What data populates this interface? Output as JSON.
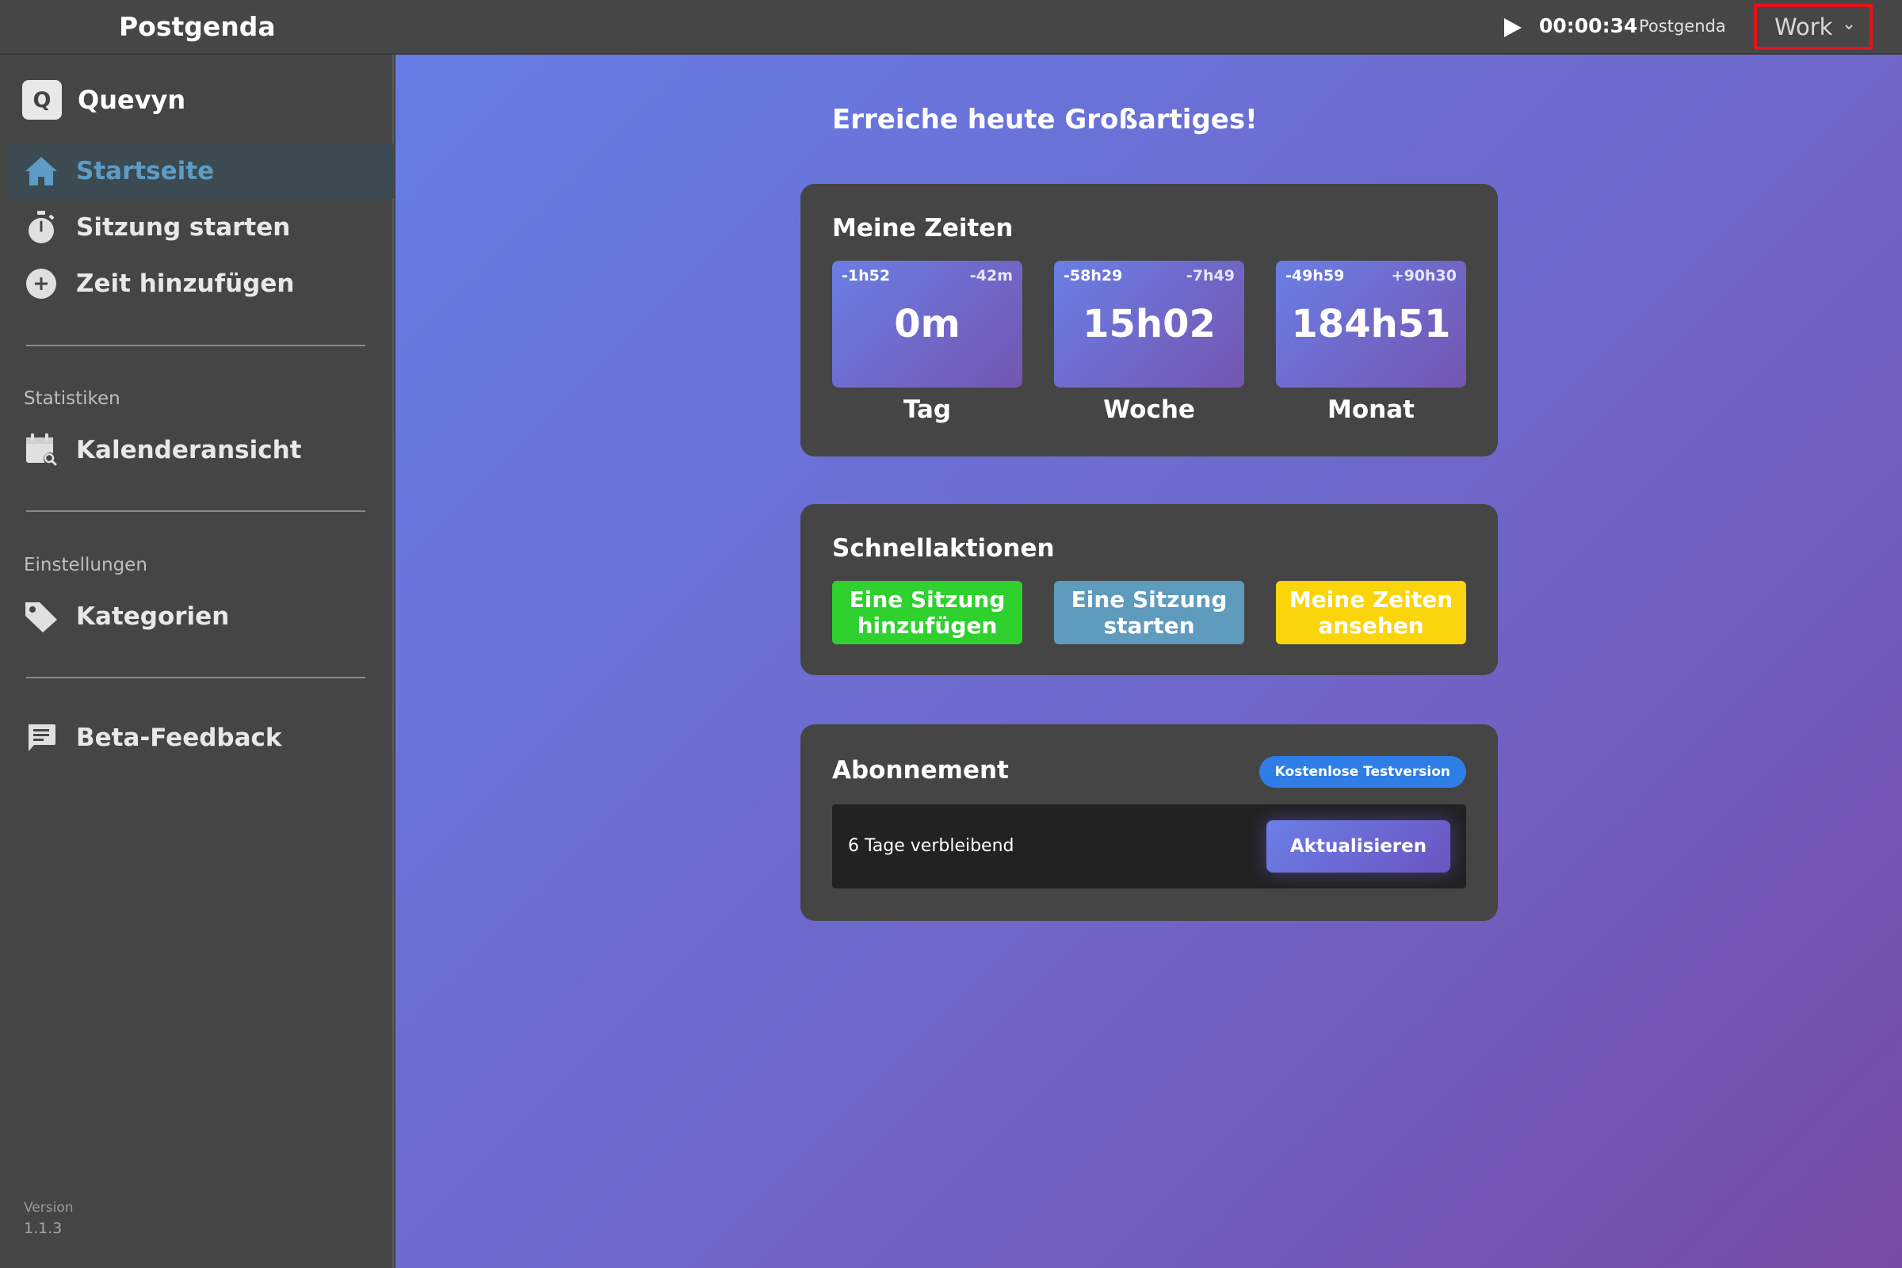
{
  "topbar": {
    "app_title": "Postgenda",
    "timer": "00:00:34",
    "project": "Postgenda",
    "category": "Work"
  },
  "sidebar": {
    "brand_initial": "Q",
    "brand_name": "Quevyn",
    "items": [
      {
        "label": "Startseite",
        "icon": "home-icon",
        "active": true
      },
      {
        "label": "Sitzung starten",
        "icon": "stopwatch-icon"
      },
      {
        "label": "Zeit hinzufügen",
        "icon": "plus-circle-icon"
      }
    ],
    "statistics": {
      "section_label": "Statistiken",
      "items": [
        {
          "label": "Kalenderansicht",
          "icon": "calendar-search-icon"
        }
      ]
    },
    "settings": {
      "section_label": "Einstellungen",
      "items": [
        {
          "label": "Kategorien",
          "icon": "tag-icon"
        }
      ]
    },
    "feedback": {
      "label": "Beta-Feedback",
      "icon": "feedback-icon"
    },
    "version_label": "Version",
    "version": "1.1.3"
  },
  "main": {
    "greeting": "Erreiche heute Großartiges!",
    "times": {
      "title": "Meine Zeiten",
      "stats": [
        {
          "left": "-1h52",
          "right": "-42m",
          "value": "0m",
          "label": "Tag"
        },
        {
          "left": "-58h29",
          "right": "-7h49",
          "value": "15h02",
          "label": "Woche"
        },
        {
          "left": "-49h59",
          "right": "+90h30",
          "value": "184h51",
          "label": "Monat"
        }
      ]
    },
    "quick_actions": {
      "title": "Schnellaktionen",
      "buttons": [
        {
          "label": "Eine Sitzung hinzufügen",
          "color": "#2ed12e"
        },
        {
          "label": "Eine Sitzung starten",
          "color": "#5e9bbd"
        },
        {
          "label": "Meine Zeiten ansehen",
          "color": "#fbd50b"
        }
      ]
    },
    "subscription": {
      "title": "Abonnement",
      "badge": "Kostenlose Testversion",
      "days_left": "6 Tage verbleibend",
      "upgrade_label": "Aktualisieren"
    }
  },
  "colors": {
    "accent_blue": "#5d9cc4",
    "badge_blue": "#2e7ee6",
    "highlight_red": "#e0141c"
  }
}
